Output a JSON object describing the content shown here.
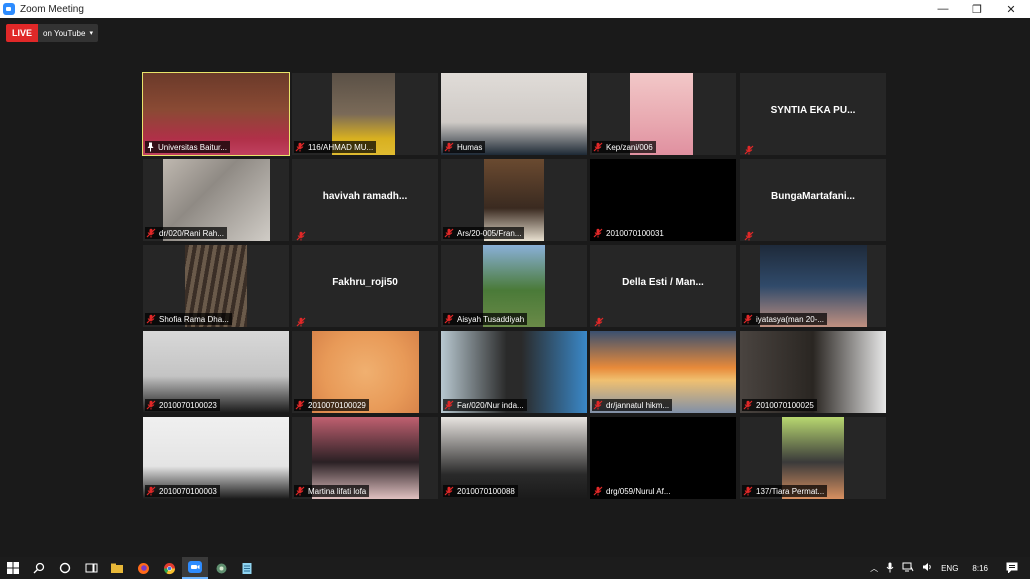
{
  "window": {
    "title": "Zoom Meeting",
    "controls": [
      "—",
      "❐",
      "✕"
    ]
  },
  "live": {
    "badge": "LIVE",
    "destination": "on YouTube",
    "caret": "▾"
  },
  "participants": [
    {
      "label": "Universitas Baitur...",
      "kind": "video",
      "active": true,
      "pinned": true
    },
    {
      "label": "116/AHMAD MU...",
      "kind": "video"
    },
    {
      "label": "Humas",
      "kind": "video"
    },
    {
      "label": "Kep/zani/006",
      "kind": "video"
    },
    {
      "label": "",
      "display_name": "SYNTIA EKA PU...",
      "kind": "name"
    },
    {
      "label": "dr/020/Rani Rah...",
      "kind": "video"
    },
    {
      "label": "",
      "display_name": "havivah  ramadh...",
      "kind": "name"
    },
    {
      "label": "Ars/20-005/Fran...",
      "kind": "video"
    },
    {
      "label": "2010070100031",
      "kind": "black"
    },
    {
      "label": "",
      "display_name": "BungaMartafani...",
      "kind": "name"
    },
    {
      "label": "Shofia Rama Dha...",
      "kind": "video"
    },
    {
      "label": "",
      "display_name": "Fakhru_roji50",
      "kind": "name"
    },
    {
      "label": "Aisyah Tusaddiyah",
      "kind": "video"
    },
    {
      "label": "",
      "display_name": "Della Esti / Man...",
      "kind": "name"
    },
    {
      "label": "iyatasya(man 20-...",
      "kind": "video"
    },
    {
      "label": "2010070100023",
      "kind": "video"
    },
    {
      "label": "2010070100029",
      "kind": "video"
    },
    {
      "label": "Far/020/Nur inda...",
      "kind": "video"
    },
    {
      "label": "dr/jannatul hikm...",
      "kind": "video"
    },
    {
      "label": "2010070100025",
      "kind": "video"
    },
    {
      "label": "2010070100003",
      "kind": "video"
    },
    {
      "label": "Martina lifati lofa",
      "kind": "video"
    },
    {
      "label": "2010070100088",
      "kind": "video"
    },
    {
      "label": "drg/059/Nurul Af...",
      "kind": "black"
    },
    {
      "label": "137/Tiara Permat...",
      "kind": "video"
    }
  ],
  "taskbar": {
    "apps": [
      "windows-start-icon",
      "search-icon",
      "cortana-icon",
      "task-view-icon",
      "file-explorer-icon",
      "firefox-icon",
      "chrome-icon",
      "zoom-icon",
      "app-icon",
      "notepad-icon"
    ],
    "tray": {
      "language": "ENG",
      "time": "8:16",
      "caret": "︿"
    }
  }
}
